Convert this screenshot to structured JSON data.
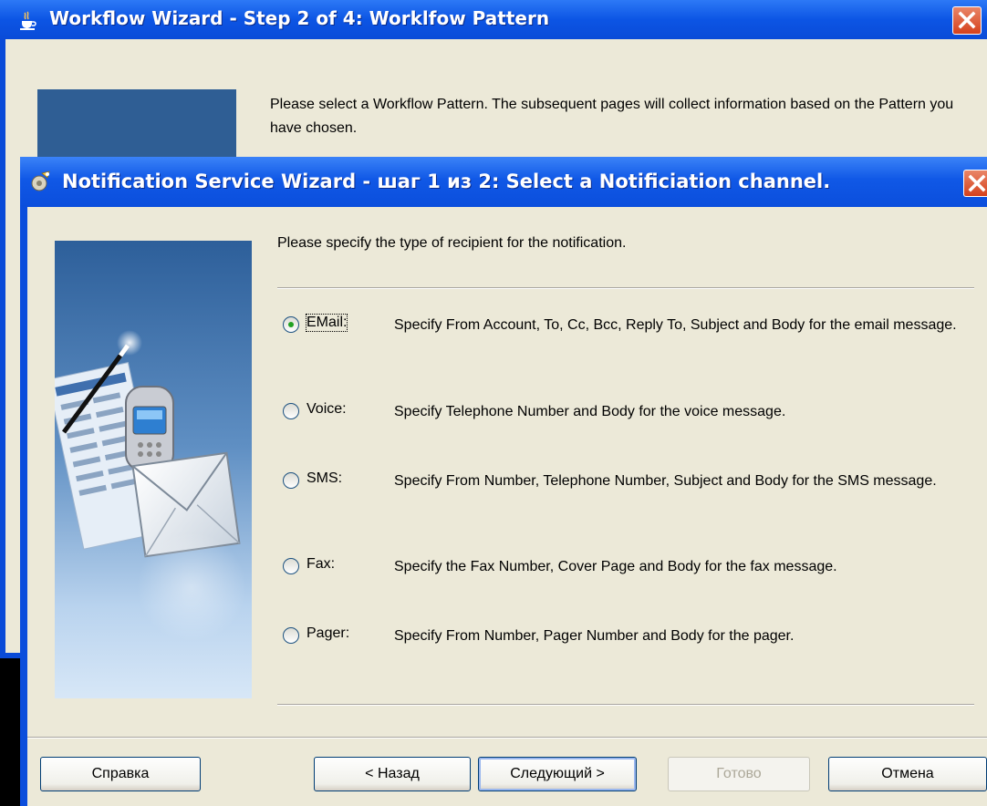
{
  "back_window": {
    "title": "Workflow Wizard - Step 2 of 4: Worklfow Pattern",
    "description": "Please select a Workflow Pattern. The subsequent pages will collect information based on the Pattern you have chosen."
  },
  "dialog": {
    "title": "Notification Service Wizard - шаг 1 из 2: Select a Notificiation channel.",
    "prompt": "Please specify the type of recipient for the notification.",
    "options": [
      {
        "label": "EMail:",
        "description": "Specify From Account, To, Cc, Bcc, Reply To, Subject and Body for the email message.",
        "selected": true
      },
      {
        "label": "Voice:",
        "description": "Specify Telephone Number and Body for the voice message.",
        "selected": false
      },
      {
        "label": "SMS:",
        "description": "Specify  From Number, Telephone Number, Subject and Body for the SMS message.",
        "selected": false
      },
      {
        "label": "Fax:",
        "description": "Specify the Fax Number, Cover Page and Body for the fax message.",
        "selected": false
      },
      {
        "label": "Pager:",
        "description": "Specify From Number, Pager Number and Body for the pager.",
        "selected": false
      }
    ],
    "buttons": {
      "help": "Справка",
      "back": "< Назад",
      "next": "Следующий >",
      "finish": "Готово",
      "cancel": "Отмена"
    }
  },
  "colors": {
    "titlebar_blue": "#0b4edc",
    "dialog_face": "#ece9d8",
    "close_red": "#d5411c"
  },
  "icons": [
    "java-cup-icon",
    "wizard-gear-icon",
    "close-icon"
  ]
}
